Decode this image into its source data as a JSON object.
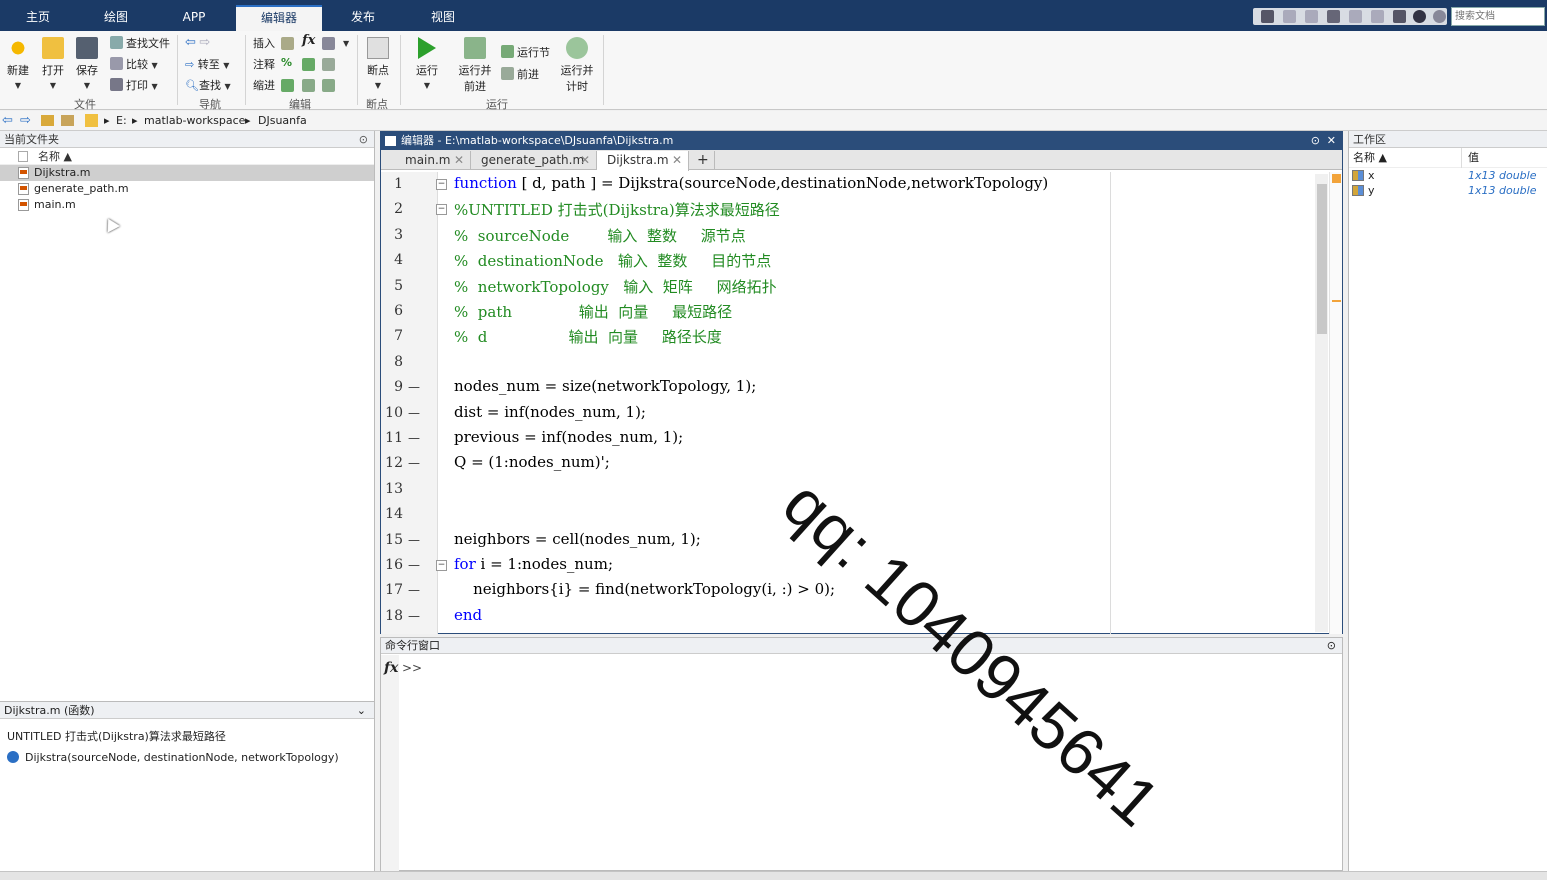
{
  "top_tabs": [
    {
      "label": "主页",
      "active": false
    },
    {
      "label": "绘图",
      "active": false
    },
    {
      "label": "APP",
      "active": false
    },
    {
      "label": "编辑器",
      "active": true
    },
    {
      "label": "发布",
      "active": false
    },
    {
      "label": "视图",
      "active": false
    }
  ],
  "search_docs_placeholder": "搜索文档",
  "ribbon": {
    "file": {
      "new": "新建",
      "open": "打开",
      "save": "保存",
      "find_files": "查找文件",
      "compare": "比较",
      "print": "打印",
      "group": "文件"
    },
    "nav": {
      "goto": "转至",
      "find": "查找",
      "group": "导航"
    },
    "edit": {
      "insert": "插入",
      "fx": "fx",
      "comment": "注释",
      "percent": "%",
      "indent": "缩进",
      "group": "编辑"
    },
    "breakpoints": {
      "label": "断点",
      "group": "断点"
    },
    "run": {
      "run": "运行",
      "run_advance_1": "运行并",
      "run_advance_2": "前进",
      "run_section": "运行节",
      "advance": "前进",
      "run_time_1": "运行并",
      "run_time_2": "计时",
      "group": "运行"
    }
  },
  "address": {
    "drive": "E:",
    "folder1": "matlab-workspace",
    "folder2": "DJsuanfa"
  },
  "current_folder": {
    "title": "当前文件夹",
    "col_name": "名称 ▲",
    "files": [
      {
        "name": "Dijkstra.m",
        "selected": true
      },
      {
        "name": "generate_path.m",
        "selected": false
      },
      {
        "name": "main.m",
        "selected": false
      }
    ]
  },
  "details": {
    "header": "Dijkstra.m  (函数)",
    "line1": "UNTITLED 打击式(Dijkstra)算法求最短路径",
    "line2": "Dijkstra(sourceNode, destinationNode, networkTopology)"
  },
  "editor": {
    "title": "编辑器 - E:\\matlab-workspace\\DJsuanfa\\Dijkstra.m",
    "tabs": [
      {
        "label": "main.m",
        "active": false
      },
      {
        "label": "generate_path.m",
        "active": false
      },
      {
        "label": "Dijkstra.m",
        "active": true
      }
    ],
    "add_tab": "+",
    "lines": [
      {
        "num": "1",
        "dash": "",
        "fold": "−",
        "parts": [
          {
            "t": "function",
            "c": "kw"
          },
          {
            "t": " [ d, path ] = Dijkstra(sourceNode,destinationNode,networkTopology)",
            "c": ""
          }
        ]
      },
      {
        "num": "2",
        "dash": "",
        "fold": "−",
        "parts": [
          {
            "t": "%UNTITLED 打击式(Dijkstra)算法求最短路径",
            "c": "cm"
          }
        ]
      },
      {
        "num": "3",
        "dash": "",
        "fold": "",
        "parts": [
          {
            "t": "%  sourceNode        输入  整数     源节点",
            "c": "cm"
          }
        ]
      },
      {
        "num": "4",
        "dash": "",
        "fold": "",
        "parts": [
          {
            "t": "%  destinationNode   输入  整数     目的节点",
            "c": "cm"
          }
        ]
      },
      {
        "num": "5",
        "dash": "",
        "fold": "",
        "parts": [
          {
            "t": "%  networkTopology   输入  矩阵     网络拓扑",
            "c": "cm"
          }
        ]
      },
      {
        "num": "6",
        "dash": "",
        "fold": "",
        "parts": [
          {
            "t": "%  path              输出  向量     最短路径",
            "c": "cm"
          }
        ]
      },
      {
        "num": "7",
        "dash": "",
        "fold": "",
        "parts": [
          {
            "t": "%  d                 输出  向量     路径长度",
            "c": "cm"
          }
        ]
      },
      {
        "num": "8",
        "dash": "",
        "fold": "",
        "parts": [
          {
            "t": "",
            "c": ""
          }
        ]
      },
      {
        "num": "9",
        "dash": "—",
        "fold": "",
        "parts": [
          {
            "t": "nodes_num = size(networkTopology, 1);",
            "c": ""
          }
        ]
      },
      {
        "num": "10",
        "dash": "—",
        "fold": "",
        "parts": [
          {
            "t": "dist = inf(nodes_num, 1);",
            "c": ""
          }
        ]
      },
      {
        "num": "11",
        "dash": "—",
        "fold": "",
        "parts": [
          {
            "t": "previous = inf(nodes_num, 1);",
            "c": ""
          }
        ]
      },
      {
        "num": "12",
        "dash": "—",
        "fold": "",
        "parts": [
          {
            "t": "Q = (1:nodes_num)';",
            "c": ""
          }
        ]
      },
      {
        "num": "13",
        "dash": "",
        "fold": "",
        "parts": [
          {
            "t": "",
            "c": ""
          }
        ]
      },
      {
        "num": "14",
        "dash": "",
        "fold": "",
        "parts": [
          {
            "t": "",
            "c": ""
          }
        ]
      },
      {
        "num": "15",
        "dash": "—",
        "fold": "",
        "parts": [
          {
            "t": "neighbors = cell(nodes_num, 1);",
            "c": ""
          }
        ]
      },
      {
        "num": "16",
        "dash": "—",
        "fold": "−",
        "parts": [
          {
            "t": "for",
            "c": "kw"
          },
          {
            "t": " i = 1:nodes_num;",
            "c": ""
          }
        ]
      },
      {
        "num": "17",
        "dash": "—",
        "fold": "",
        "parts": [
          {
            "t": "    neighbors{i} = find(networkTopology(i, :) > 0);",
            "c": ""
          }
        ]
      },
      {
        "num": "18",
        "dash": "—",
        "fold": "",
        "parts": [
          {
            "t": "end",
            "c": "kw"
          }
        ]
      }
    ]
  },
  "command_window": {
    "title": "命令行窗口",
    "fx": "fx",
    "prompt": ">>"
  },
  "workspace": {
    "title": "工作区",
    "col_name": "名称 ▲",
    "col_value": "值",
    "vars": [
      {
        "name": "x",
        "value": "1x13 double"
      },
      {
        "name": "y",
        "value": "1x13 double"
      }
    ]
  },
  "watermark": "qq: 1040945641",
  "colors": {
    "title_bar": "#1b3a66",
    "keyword": "#0000ff",
    "comment": "#228b22",
    "accent": "#2b6fc4"
  }
}
